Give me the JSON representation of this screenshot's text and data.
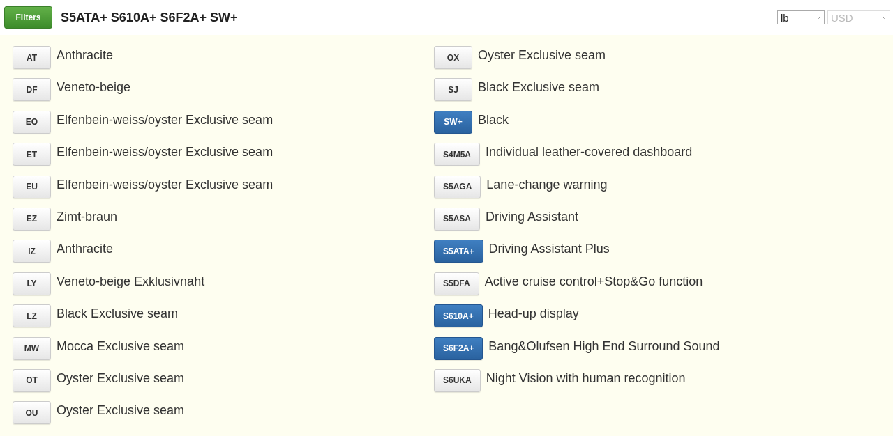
{
  "header": {
    "filter_button": "Filters",
    "title": "S5ATA+ S610A+ S6F2A+ SW+",
    "selects": [
      {
        "value": "lb",
        "disabled": false
      },
      {
        "value": "USD",
        "disabled": true
      }
    ]
  },
  "columns": [
    [
      {
        "code": "AT",
        "label": "Anthracite",
        "selected": false
      },
      {
        "code": "DF",
        "label": "Veneto-beige",
        "selected": false
      },
      {
        "code": "EO",
        "label": "Elfenbein-weiss/oyster Exclusive seam",
        "selected": false
      },
      {
        "code": "ET",
        "label": "Elfenbein-weiss/oyster Exclusive seam",
        "selected": false
      },
      {
        "code": "EU",
        "label": "Elfenbein-weiss/oyster Exclusive seam",
        "selected": false
      },
      {
        "code": "EZ",
        "label": "Zimt-braun",
        "selected": false
      },
      {
        "code": "IZ",
        "label": "Anthracite",
        "selected": false
      },
      {
        "code": "LY",
        "label": "Veneto-beige Exklusivnaht",
        "selected": false
      },
      {
        "code": "LZ",
        "label": "Black Exclusive seam",
        "selected": false
      },
      {
        "code": "MW",
        "label": "Mocca Exclusive seam",
        "selected": false
      },
      {
        "code": "OT",
        "label": "Oyster Exclusive seam",
        "selected": false
      },
      {
        "code": "OU",
        "label": "Oyster Exclusive seam",
        "selected": false
      }
    ],
    [
      {
        "code": "OX",
        "label": "Oyster Exclusive seam",
        "selected": false
      },
      {
        "code": "SJ",
        "label": "Black Exclusive seam",
        "selected": false
      },
      {
        "code": "SW+",
        "label": "Black",
        "selected": true
      },
      {
        "code": "S4M5A",
        "label": "Individual leather-covered dashboard",
        "selected": false
      },
      {
        "code": "S5AGA",
        "label": "Lane-change warning",
        "selected": false
      },
      {
        "code": "S5ASA",
        "label": "Driving Assistant",
        "selected": false
      },
      {
        "code": "S5ATA+",
        "label": "Driving Assistant Plus",
        "selected": true
      },
      {
        "code": "S5DFA",
        "label": "Active cruise control+Stop&Go function",
        "selected": false
      },
      {
        "code": "S610A+",
        "label": "Head-up display",
        "selected": true
      },
      {
        "code": "S6F2A+",
        "label": "Bang&Olufsen High End Surround Sound",
        "selected": true
      },
      {
        "code": "S6UKA",
        "label": "Night Vision with human recognition",
        "selected": false
      }
    ]
  ]
}
